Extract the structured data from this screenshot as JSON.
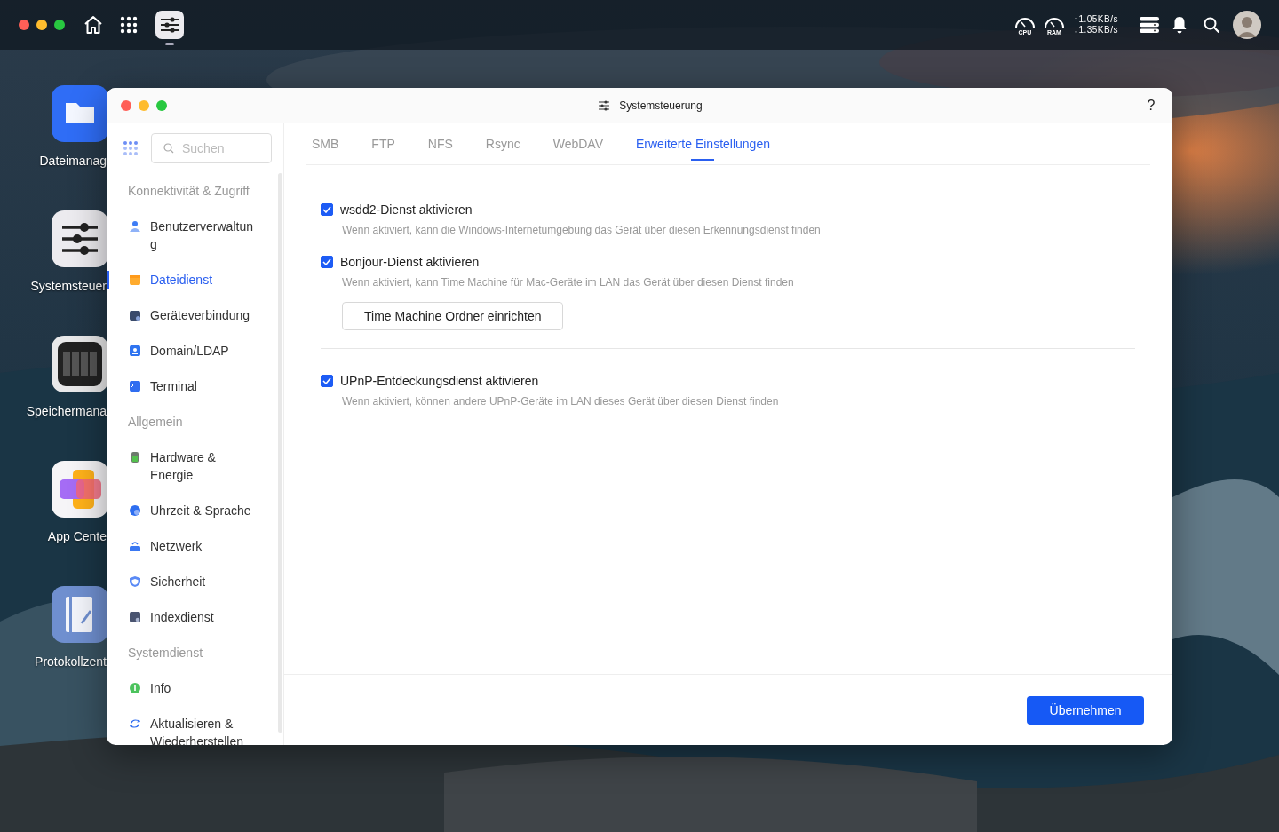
{
  "top_bar": {
    "cpu_label": "CPU",
    "ram_label": "RAM",
    "upload": "↑1.05KB/s",
    "download": "↓1.35KB/s"
  },
  "desktop_icons": [
    {
      "kind": "files",
      "label": "Dateimanag"
    },
    {
      "kind": "settings",
      "label": "Systemsteuer"
    },
    {
      "kind": "storage",
      "label": "Speichermana"
    },
    {
      "kind": "apps",
      "label": "App Cente"
    },
    {
      "kind": "log",
      "label": "Protokollzent"
    }
  ],
  "window": {
    "title": "Systemsteuerung",
    "help": "?"
  },
  "sidebar": {
    "search_placeholder": "Suchen",
    "groups": [
      {
        "title": "Konnektivität & Zugriff",
        "items": [
          {
            "kind": "user",
            "label": "Benutzerverwaltung",
            "selected": false
          },
          {
            "kind": "folder",
            "label": "Dateidienst",
            "selected": true
          },
          {
            "kind": "device",
            "label": "Geräteverbindung",
            "selected": false
          },
          {
            "kind": "domain",
            "label": "Domain/LDAP",
            "selected": false
          },
          {
            "kind": "terminal",
            "label": "Terminal",
            "selected": false
          }
        ]
      },
      {
        "title": "Allgemein",
        "items": [
          {
            "kind": "hardware",
            "label": "Hardware & Energie",
            "selected": false
          },
          {
            "kind": "clock",
            "label": "Uhrzeit & Sprache",
            "selected": false
          },
          {
            "kind": "network",
            "label": "Netzwerk",
            "selected": false
          },
          {
            "kind": "shield",
            "label": "Sicherheit",
            "selected": false
          },
          {
            "kind": "index",
            "label": "Indexdienst",
            "selected": false
          }
        ]
      },
      {
        "title": "Systemdienst",
        "items": [
          {
            "kind": "info",
            "label": "Info",
            "selected": false
          },
          {
            "kind": "update",
            "label": "Aktualisieren & Wiederherstellen",
            "selected": false
          }
        ]
      }
    ]
  },
  "tabs": [
    {
      "label": "SMB",
      "selected": false
    },
    {
      "label": "FTP",
      "selected": false
    },
    {
      "label": "NFS",
      "selected": false
    },
    {
      "label": "Rsync",
      "selected": false
    },
    {
      "label": "WebDAV",
      "selected": false
    },
    {
      "label": "Erweiterte Einstellungen",
      "selected": true
    }
  ],
  "options": [
    {
      "label": "wsdd2-Dienst aktivieren",
      "checked": true,
      "description": "Wenn aktiviert, kann die Windows-Internetumgebung das Gerät über diesen Erkennungsdienst finden"
    },
    {
      "label": "Bonjour-Dienst aktivieren",
      "checked": true,
      "description": "Wenn aktiviert, kann Time Machine für Mac-Geräte im LAN das Gerät über diesen Dienst finden",
      "button": "Time Machine Ordner einrichten",
      "divider_after": true
    },
    {
      "label": "UPnP-Entdeckungsdienst aktivieren",
      "checked": true,
      "description": "Wenn aktiviert, können andere UPnP-Geräte im LAN dieses Gerät über diesen Dienst finden"
    }
  ],
  "apply_button": "Übernehmen"
}
